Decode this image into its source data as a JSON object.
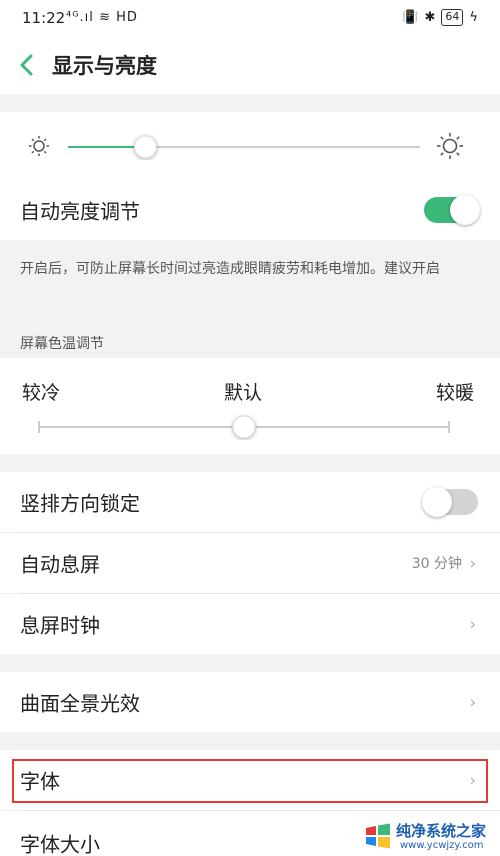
{
  "status_bar": {
    "time": "11:22",
    "signal": "⁴ᴳ.ıl",
    "hd": "HD",
    "battery": "64"
  },
  "header": {
    "title": "显示与亮度"
  },
  "brightness": {
    "level": 0.22,
    "auto_label": "自动亮度调节",
    "auto_on": true
  },
  "note": {
    "text": "开启后，可防止屏幕长时间过亮造成眼睛疲劳和耗电增加。建议开启"
  },
  "color_temp": {
    "section_title": "屏幕色温调节",
    "cool_label": "较冷",
    "default_label": "默认",
    "warm_label": "较暖",
    "level": 0.5
  },
  "rows": {
    "orientation_lock": {
      "label": "竖排方向锁定",
      "on": false
    },
    "screen_timeout": {
      "label": "自动息屏",
      "value": "30 分钟"
    },
    "screen_off_clock": {
      "label": "息屏时钟"
    },
    "curved_edge": {
      "label": "曲面全景光效"
    },
    "font": {
      "label": "字体"
    },
    "font_size": {
      "label": "字体大小"
    }
  },
  "watermark": {
    "title": "纯净系统之家",
    "url": "www.ycwjzy.com"
  },
  "colors": {
    "accent": "#3cb878",
    "highlight": "#e53935"
  }
}
